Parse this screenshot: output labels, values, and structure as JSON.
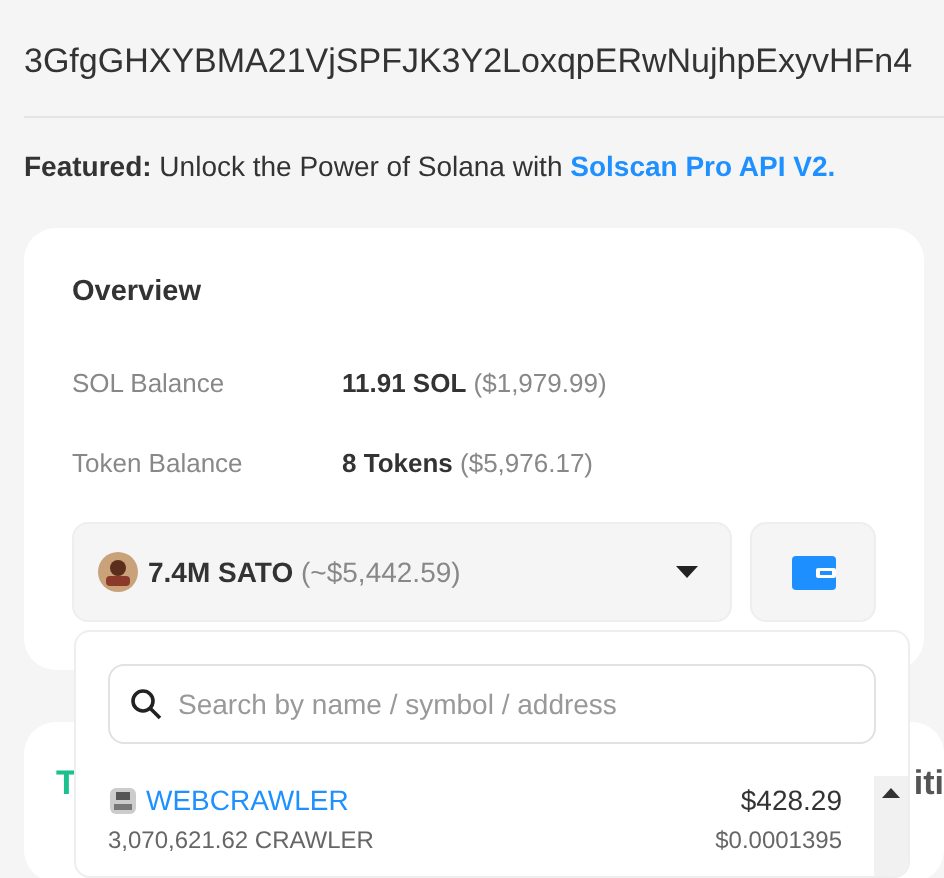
{
  "address": "3GfgGHXYBMA21VjSPFJK3Y2LoxqpERwNujhpExyvHFn4",
  "featured": "**Featured:** Unlock the Power of Solana with ",
  "featured_link": "Solscan Pro API V2.",
  "overview": {
    "title": "Overview",
    "rows": [
      {
        "label": "SOL Balance",
        "value": "11.91 SOL",
        "usd": "($1,979.99)"
      },
      {
        "label": "Token Balance",
        "value": "8 Tokens",
        "usd": "($5,976.17)"
      }
    ],
    "token_select": {
      "value": "7.4M SATO",
      "usd": "(~$5,442.59)",
      "expanded": true
    }
  },
  "tabs_card": {
    "tabs": [
      {
        "label": "T",
        "selected": true
      },
      {
        "label": "iti",
        "selected": false
      }
    ]
  },
  "dropdown": {
    "placeholder": "Search by name / symbol / address",
    "tokens": [
      {
        "name": "WEBCRAWLER",
        "value": "$428.29",
        "amount": "3,070,621.62 CRAWLER",
        "price": "$0.0001395"
      }
    ]
  }
}
